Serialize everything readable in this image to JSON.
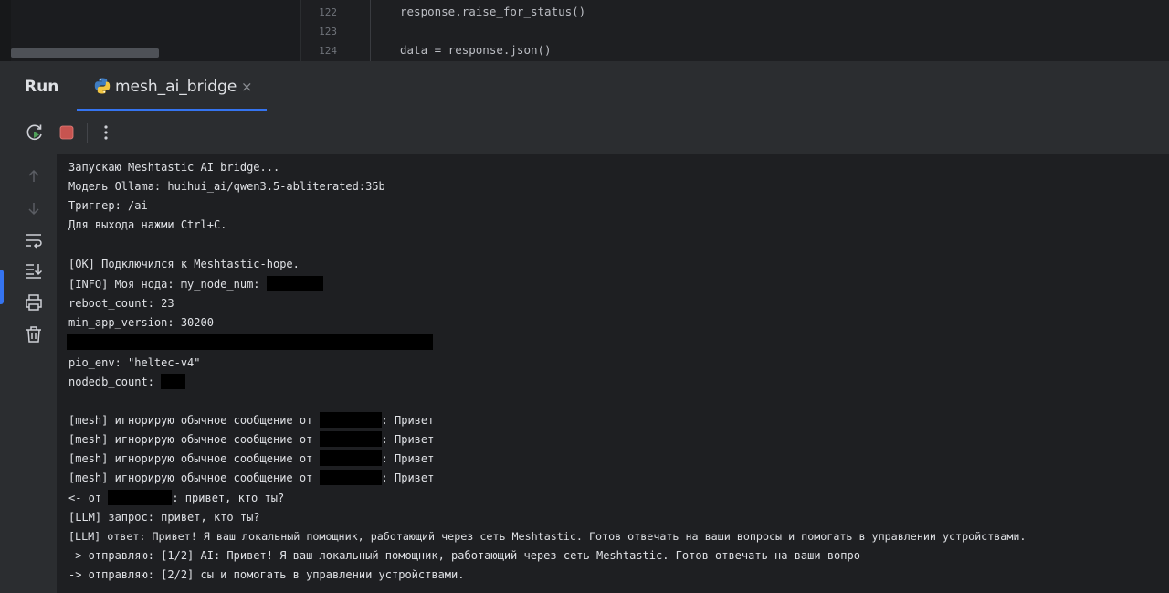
{
  "editor": {
    "lines": [
      {
        "num": "122",
        "code": "response.raise_for_status()"
      },
      {
        "num": "123",
        "code": ""
      },
      {
        "num": "124",
        "code": "data = response.json()"
      }
    ]
  },
  "run_panel": {
    "title": "Run",
    "tab": {
      "label": "mesh_ai_bridge",
      "close": "×"
    }
  },
  "toolbar": {
    "icons": [
      "rerun-icon",
      "stop-icon",
      "more-options-icon"
    ]
  },
  "side_icons": [
    "scroll-up-icon",
    "scroll-down-icon",
    "soft-wrap-icon",
    "scroll-to-end-icon",
    "print-icon",
    "clear-icon"
  ],
  "colors": {
    "accent": "#3574f0",
    "stop": "#c75450",
    "rerun": "#4fa059"
  },
  "console": {
    "lines": [
      {
        "text": "Запускаю Meshtastic AI bridge..."
      },
      {
        "text": "Модель Ollama: huihui_ai/qwen3.5-abliterated:35b"
      },
      {
        "text": "Триггер: /ai"
      },
      {
        "text": "Для выхода нажми Ctrl+C."
      },
      {
        "text": ""
      },
      {
        "text": "[OK] Подключился к Meshtastic-hope."
      },
      {
        "text": "[INFO] Моя нода: my_node_num: ",
        "after": ""
      },
      {
        "text": "reboot_count: 23"
      },
      {
        "text": "min_app_version: 30200"
      },
      {
        "text": "",
        "redact_only": true
      },
      {
        "text": "pio_env: \"heltec-v4\""
      },
      {
        "text": "nodedb_count: ",
        "after": ""
      },
      {
        "text": ""
      },
      {
        "text": "[mesh] игнорирую обычное сообщение от ",
        "after": ": Привет"
      },
      {
        "text": "[mesh] игнорирую обычное сообщение от ",
        "after": ": Привет"
      },
      {
        "text": "[mesh] игнорирую обычное сообщение от ",
        "after": ": Привет"
      },
      {
        "text": "[mesh] игнорирую обычное сообщение от ",
        "after": ": Привет"
      },
      {
        "text": "<- от ",
        "after": ": привет, кто ты?"
      },
      {
        "text": "[LLM] запрос: привет, кто ты?"
      },
      {
        "text": "[LLM] ответ: Привет! Я ваш локальный помощник, работающий через сеть Meshtastic. Готов отвечать на ваши вопросы и помогать в управлении устройствами."
      },
      {
        "text": "-> отправляю: [1/2] AI: Привет! Я ваш локальный помощник, работающий через сеть Meshtastic. Готов отвечать на ваши вопро"
      },
      {
        "text": "-> отправляю: [2/2] сы и помогать в управлении устройствами."
      }
    ]
  }
}
